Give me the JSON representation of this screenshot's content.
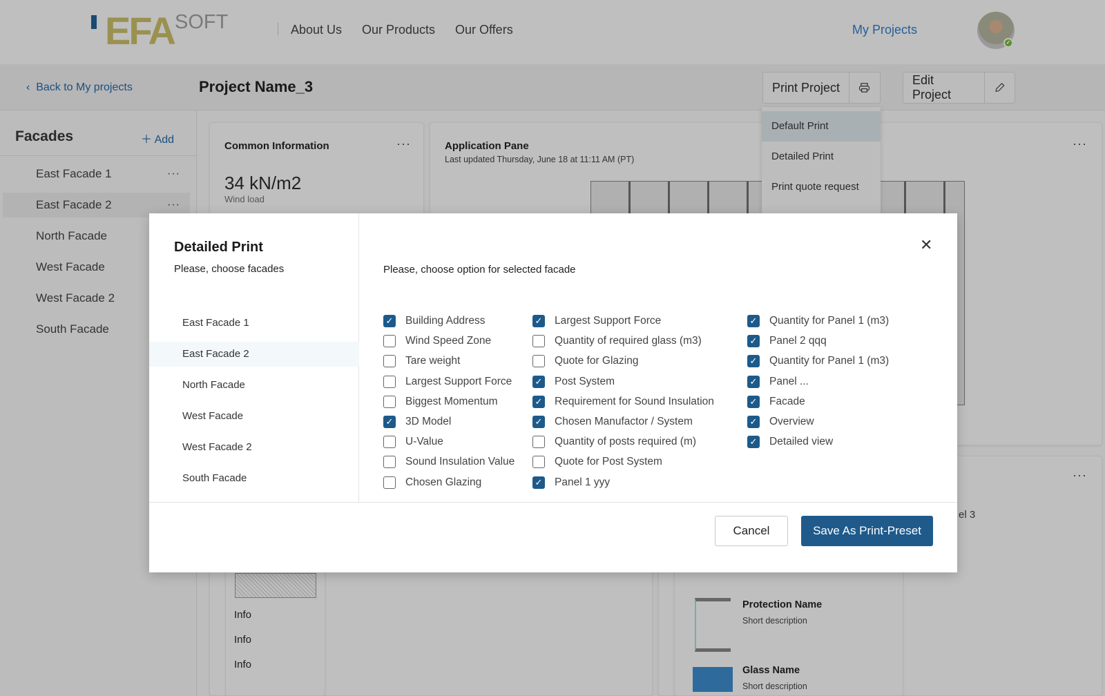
{
  "header": {
    "logo_text": "EFA",
    "logo_sub": "SOFT",
    "nav": [
      "About Us",
      "Our Products",
      "Our Offers"
    ],
    "my_projects": "My Projects",
    "status_color": "#5a8f2a"
  },
  "subheader": {
    "back": "Back to My projects",
    "title": "Project Name_3",
    "print_label": "Print Project",
    "edit_label": "Edit Project"
  },
  "print_menu": [
    "Default Print",
    "Detailed Print",
    "Print quote request"
  ],
  "sidebar": {
    "title": "Facades",
    "add": "Add",
    "items": [
      "East Facade 1",
      "East Facade 2",
      "North Facade",
      "West Facade",
      "West Facade 2",
      "South Facade"
    ]
  },
  "common": {
    "title": "Common Information",
    "value": "34 kN/m2",
    "label": "Wind load"
  },
  "app_pane": {
    "title": "Application Pane",
    "updated": "Last updated Thursday, June 18 at 11:11 AM (PT)"
  },
  "bg": {
    "info": [
      "Info",
      "Info",
      "Info"
    ],
    "partial": "el 3",
    "protection_name": "Protection Name",
    "protection_desc": "Short description",
    "glass_name": "Glass Name",
    "glass_desc": "Short description",
    "glass_color": "#2e6a9c"
  },
  "modal": {
    "title": "Detailed Print",
    "subtitle": "Please, choose facades",
    "facades": [
      "East Facade 1",
      "East Facade 2",
      "North Facade",
      "West Facade",
      "West Facade 2",
      "South Facade"
    ],
    "selected_facade": "East Facade 2",
    "options_heading": "Please, choose option for selected facade",
    "columns": [
      [
        {
          "label": "Building Address",
          "checked": true
        },
        {
          "label": "Wind Speed Zone",
          "checked": false
        },
        {
          "label": "Tare weight",
          "checked": false
        },
        {
          "label": "Largest Support Force",
          "checked": false
        },
        {
          "label": "Biggest Momentum",
          "checked": false
        },
        {
          "label": "3D Model",
          "checked": true
        },
        {
          "label": "U-Value",
          "checked": false
        },
        {
          "label": "Sound Insulation Value",
          "checked": false
        },
        {
          "label": "Chosen Glazing",
          "checked": false
        }
      ],
      [
        {
          "label": "Largest Support Force",
          "checked": true
        },
        {
          "label": "Quantity of required glass (m3)",
          "checked": false
        },
        {
          "label": "Quote for Glazing",
          "checked": false
        },
        {
          "label": "Post System",
          "checked": true
        },
        {
          "label": "Requirement for Sound Insulation",
          "checked": true
        },
        {
          "label": "Chosen Manufactor / System",
          "checked": true
        },
        {
          "label": "Quantity of posts required (m)",
          "checked": false
        },
        {
          "label": "Quote for Post System",
          "checked": false
        },
        {
          "label": "Panel 1 yyy",
          "checked": true
        }
      ],
      [
        {
          "label": "Quantity for Panel 1 (m3)",
          "checked": true
        },
        {
          "label": "Panel 2 qqq",
          "checked": true
        },
        {
          "label": "Quantity for Panel 1 (m3)",
          "checked": true
        },
        {
          "label": "Panel ...",
          "checked": true
        },
        {
          "label": "Facade",
          "checked": true
        },
        {
          "label": "Overview",
          "checked": true
        },
        {
          "label": "Detailed view",
          "checked": true
        }
      ]
    ],
    "cancel": "Cancel",
    "save": "Save As Print-Preset",
    "accent": "#1f5a8b"
  }
}
